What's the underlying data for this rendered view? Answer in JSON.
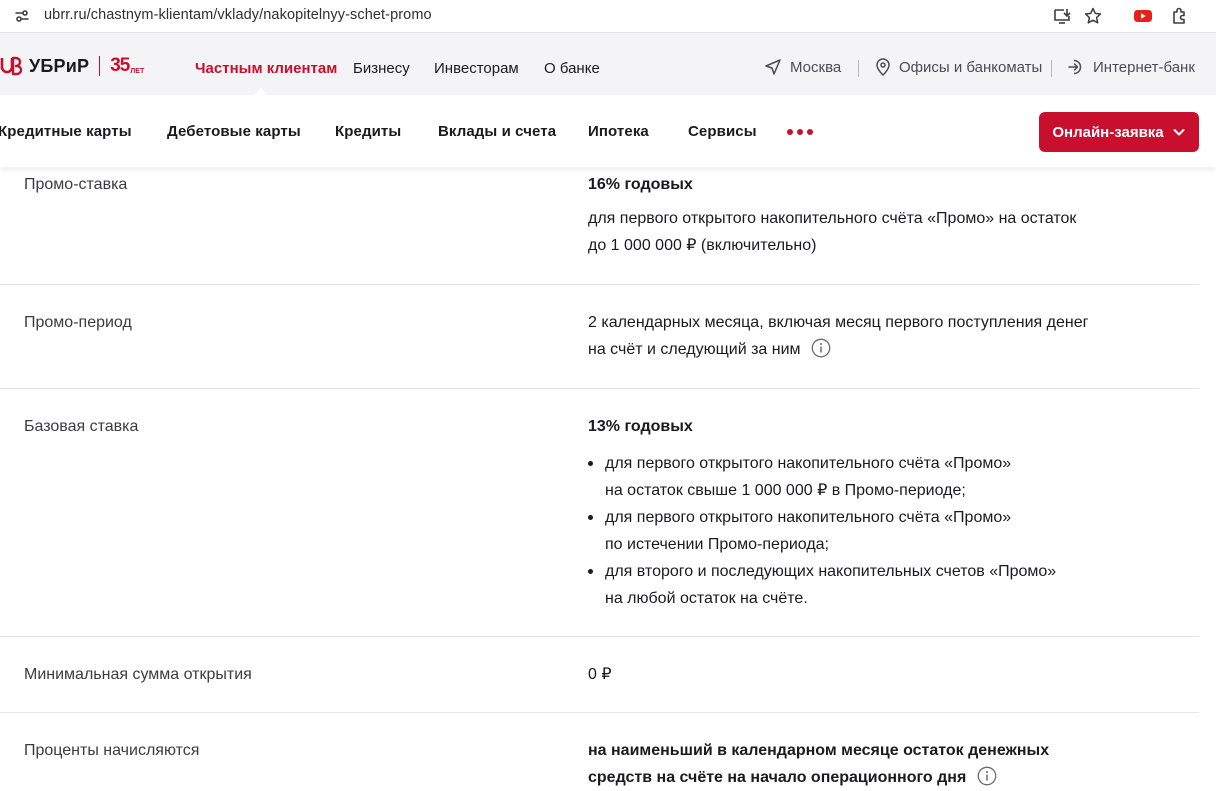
{
  "browser": {
    "url": "ubrr.ru/chastnym-klientam/vklady/nakopitelnyy-schet-promo",
    "icons": [
      "site-info-icon",
      "install-app-icon",
      "bookmark-star-icon",
      "youtube-extension-icon",
      "extensions-puzzle-icon"
    ]
  },
  "brand": {
    "name": "УБРиР",
    "years": "35",
    "years_suffix": "ЛЕТ",
    "accent_color": "#c8102e"
  },
  "nav_top": {
    "links": [
      "Частным клиентам",
      "Бизнесу",
      "Инвесторам",
      "О банке"
    ],
    "active_index": 0,
    "city": "Москва",
    "offices": "Офисы и банкоматы",
    "internet_bank": "Интернет-банк"
  },
  "nav_main": {
    "items": [
      "Кредитные карты",
      "Дебетовые карты",
      "Кредиты",
      "Вклады и счета",
      "Ипотека",
      "Сервисы"
    ],
    "cta_label": "Онлайн-заявка"
  },
  "main": {
    "rows": [
      {
        "label": "Промо-ставка",
        "value": {
          "title": "16% годовых",
          "line1": "для первого открытого накопительного счёта «Промо» на остаток",
          "line2": "до 1 000 000 ₽ (включительно)"
        }
      },
      {
        "label": "Промо-период",
        "value": {
          "line1": "2 календарных месяца, включая месяц первого поступления денег",
          "line2": "на счёт и следующий за ним"
        }
      },
      {
        "label": "Базовая ставка",
        "value": {
          "title": "13% годовых",
          "bullets": [
            {
              "line1": "для первого открытого накопительного счёта «Промо»",
              "line2": "на остаток свыше 1 000 000 ₽ в Промо-периоде;"
            },
            {
              "line1": "для первого открытого накопительного счёта «Промо»",
              "line2": "по истечении Промо-периода;"
            },
            {
              "line1": "для второго и последующих накопительных счетов «Промо»",
              "line2": "на любой остаток на счёте."
            }
          ]
        }
      },
      {
        "label": "Минимальная сумма открытия",
        "value": {
          "line1": "0 ₽"
        }
      },
      {
        "label": "Проценты начисляются",
        "value": {
          "line1": "на наименьший в календарном месяце остаток денежных",
          "line2": "средств на счёте на начало операционного дня"
        }
      }
    ]
  }
}
